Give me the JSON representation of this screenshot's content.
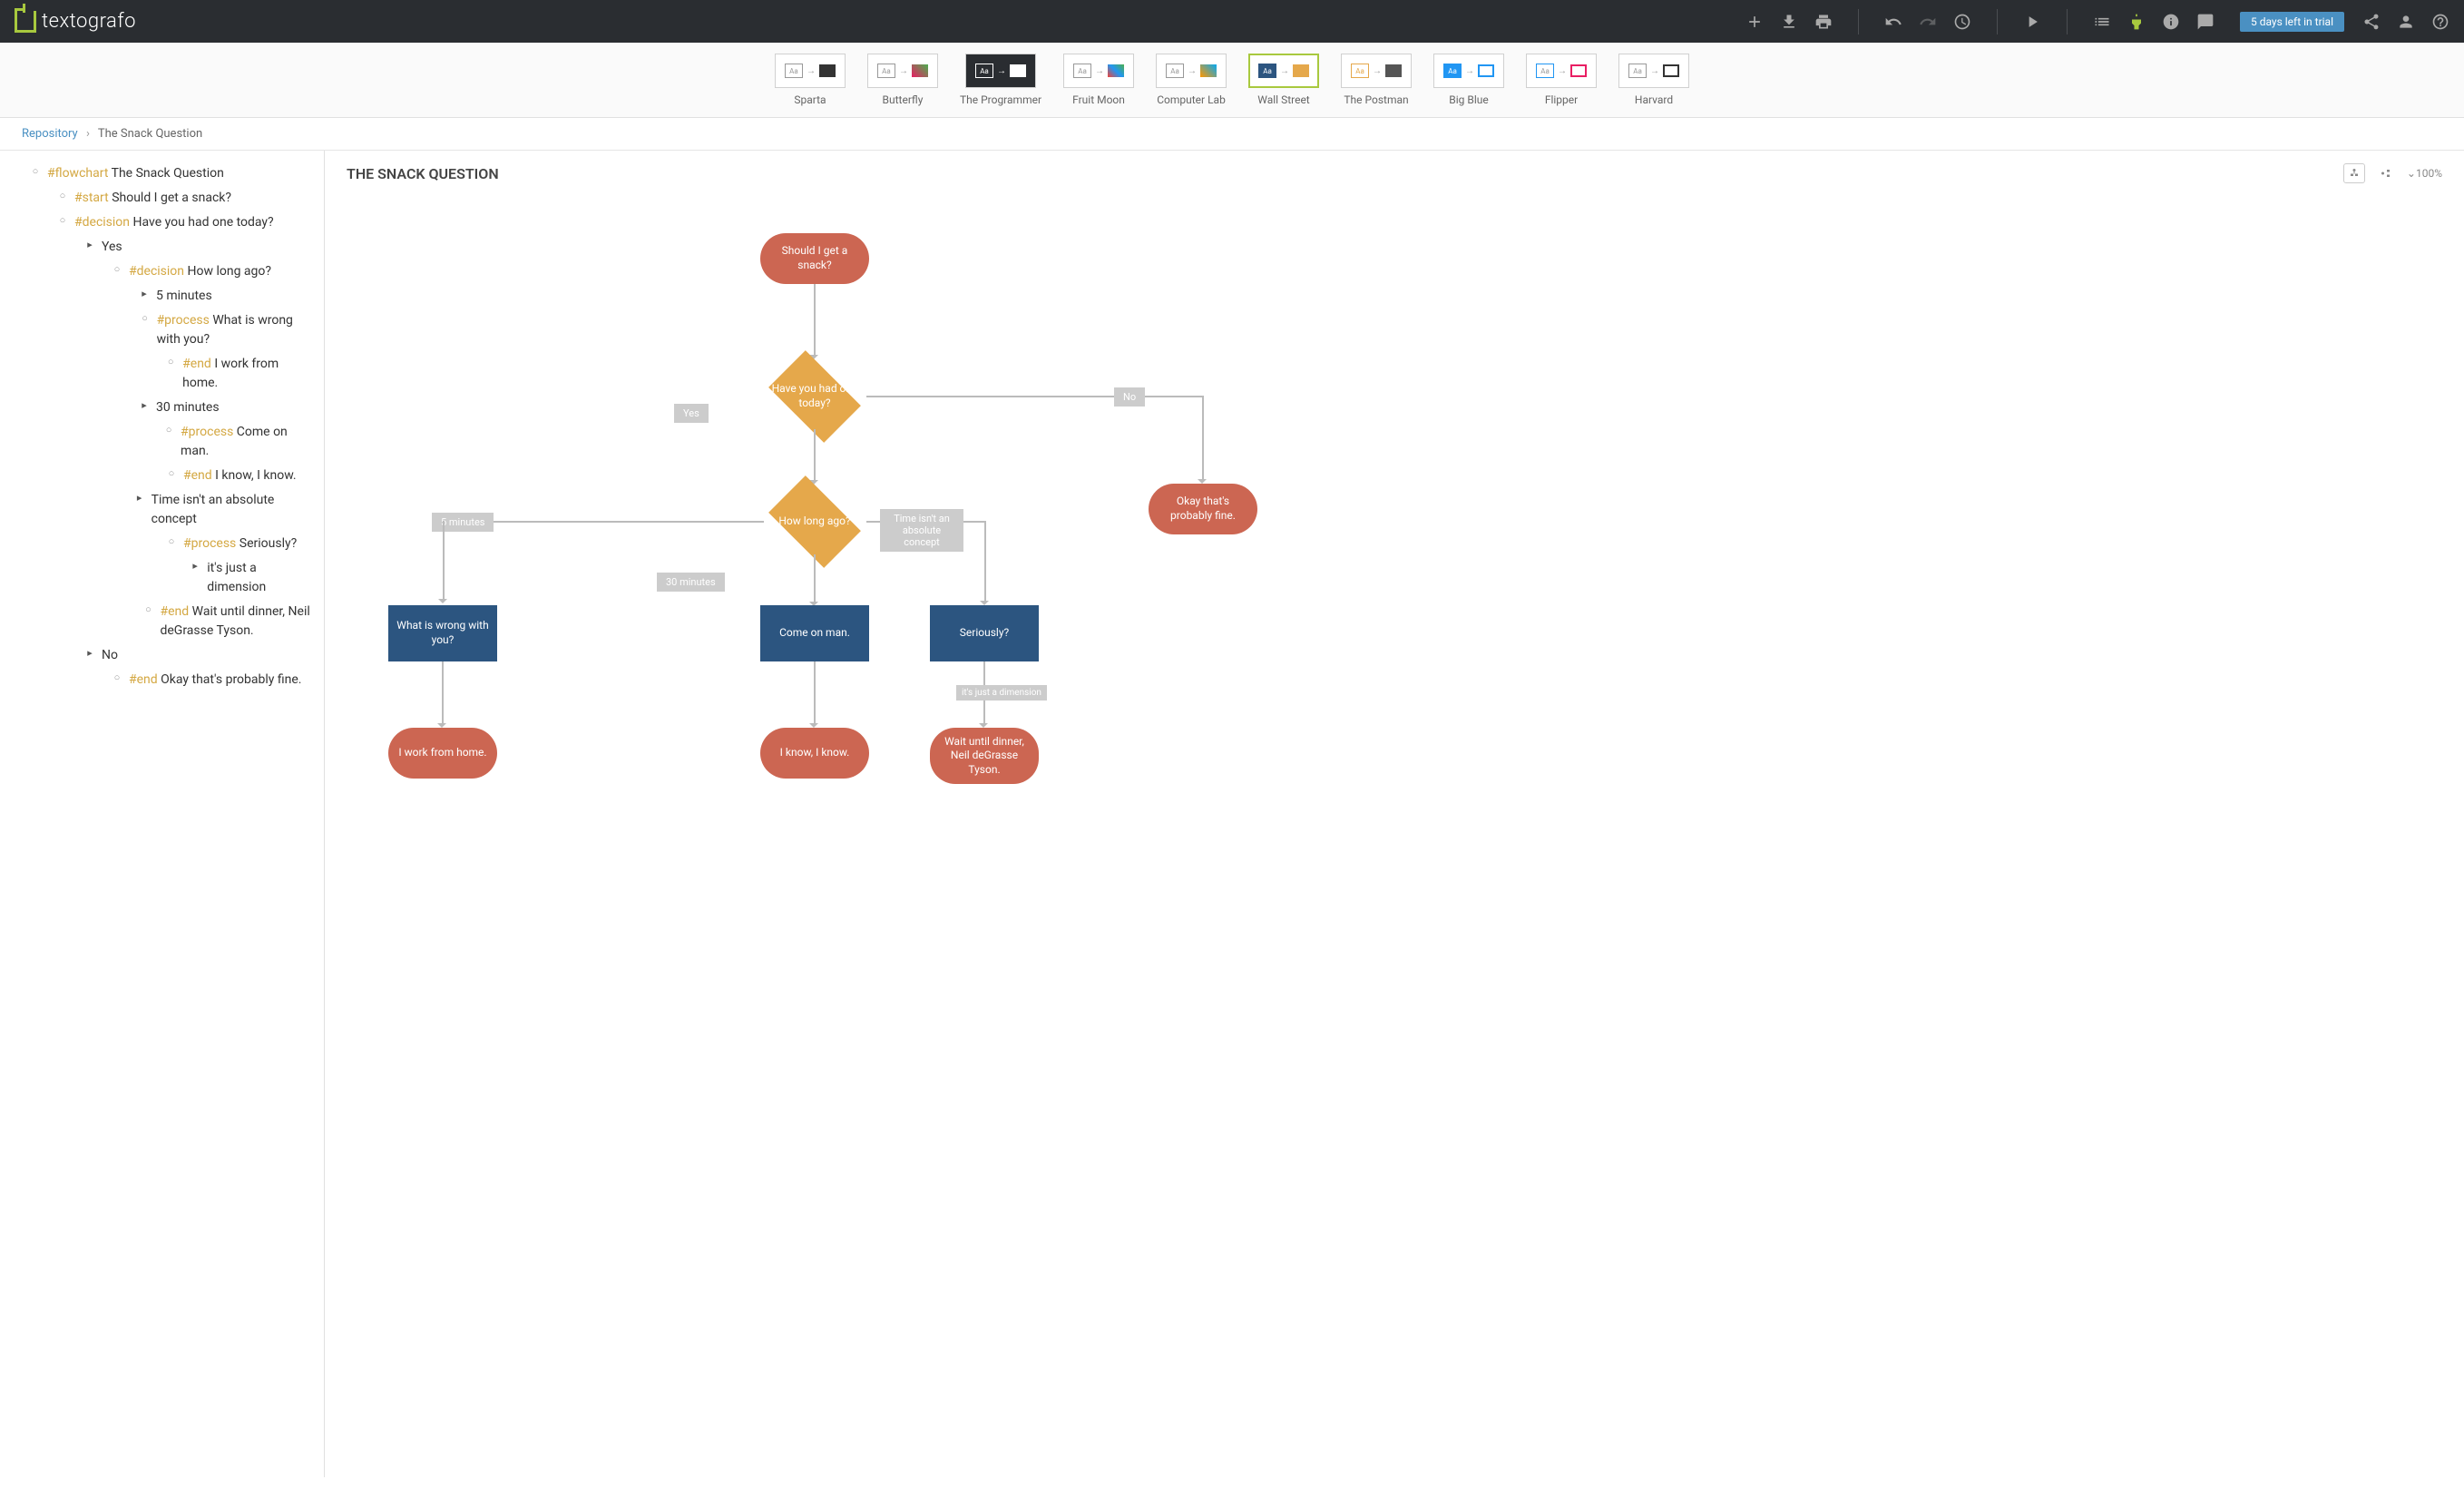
{
  "app": {
    "name": "textografo"
  },
  "topbar": {
    "trial_badge": "5 days left in trial"
  },
  "gallery": [
    {
      "label": "Sparta"
    },
    {
      "label": "Butterfly"
    },
    {
      "label": "The Programmer"
    },
    {
      "label": "Fruit Moon"
    },
    {
      "label": "Computer Lab"
    },
    {
      "label": "Wall Street"
    },
    {
      "label": "The Postman"
    },
    {
      "label": "Big Blue"
    },
    {
      "label": "Flipper"
    },
    {
      "label": "Harvard"
    }
  ],
  "breadcrumb": {
    "root": "Repository",
    "current": "The Snack Question"
  },
  "canvas": {
    "title": "THE SNACK QUESTION",
    "zoom": "100%"
  },
  "outline": [
    {
      "indent": 0,
      "bullet": "o",
      "tag": "#flowchart",
      "text": "The Snack Question"
    },
    {
      "indent": 1,
      "bullet": "o",
      "tag": "#start",
      "text": "Should I get a snack?"
    },
    {
      "indent": 1,
      "bullet": "o",
      "tag": "#decision",
      "text": "Have you had one today?"
    },
    {
      "indent": 2,
      "bullet": ">",
      "tag": "",
      "text": "Yes"
    },
    {
      "indent": 3,
      "bullet": "o",
      "tag": "#decision",
      "text": "How long ago?"
    },
    {
      "indent": 4,
      "bullet": ">",
      "tag": "",
      "text": "5 minutes"
    },
    {
      "indent": 5,
      "bullet": "o",
      "tag": "#process",
      "text": " What is wrong with you?"
    },
    {
      "indent": 5,
      "bullet": "o",
      "tag": "#end",
      "text": "I work from home."
    },
    {
      "indent": 4,
      "bullet": ">",
      "tag": "",
      "text": "30 minutes"
    },
    {
      "indent": 5,
      "bullet": "o",
      "tag": "#process",
      "text": "Come on man."
    },
    {
      "indent": 5,
      "bullet": "o",
      "tag": "#end",
      "text": "I know, I know."
    },
    {
      "indent": 4,
      "bullet": ">",
      "tag": "",
      "text": "Time isn't an absolute concept"
    },
    {
      "indent": 5,
      "bullet": "o",
      "tag": "#process",
      "text": "Seriously?"
    },
    {
      "indent": 6,
      "bullet": ">",
      "tag": "",
      "text": "it's just a dimension"
    },
    {
      "indent": 7,
      "bullet": "o",
      "tag": "#end",
      "text": "Wait until dinner, Neil deGrasse Tyson."
    },
    {
      "indent": 2,
      "bullet": ">",
      "tag": "",
      "text": "No"
    },
    {
      "indent": 3,
      "bullet": "o",
      "tag": "#end",
      "text": "Okay that's probably fine."
    }
  ],
  "flow": {
    "start": "Should I get a snack?",
    "d1": "Have you had one today?",
    "d2": "How long ago?",
    "p1": "What is wrong with you?",
    "p2": "Come on man.",
    "p3": "Seriously?",
    "e1": "I work from home.",
    "e2": "I know, I know.",
    "e3": "Wait until dinner, Neil deGrasse Tyson.",
    "e4": "Okay that's probably fine.",
    "l_yes": "Yes",
    "l_no": "No",
    "l_5": "5 minutes",
    "l_30": "30 minutes",
    "l_time": "Time isn't an absolute concept",
    "l_dim": "it's just a dimension"
  }
}
